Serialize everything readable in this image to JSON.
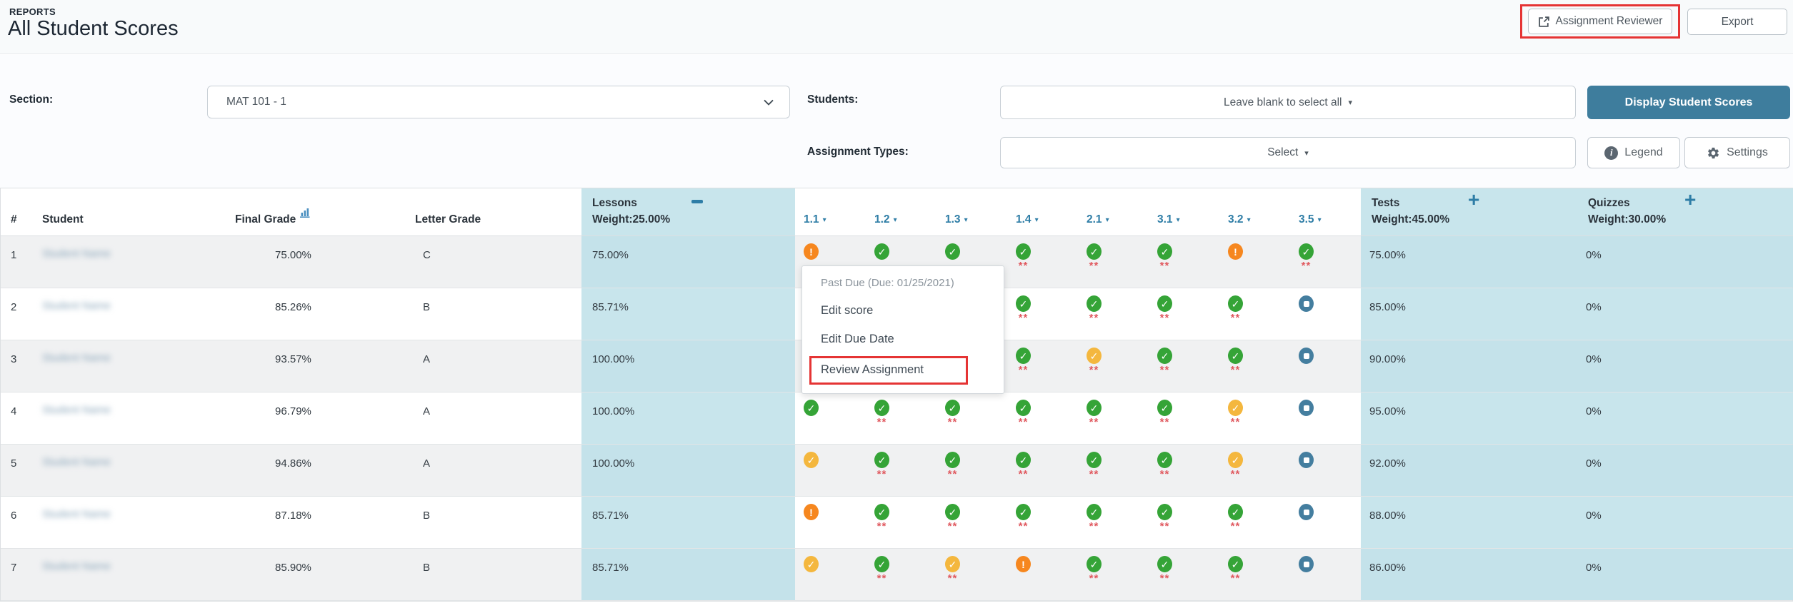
{
  "page": {
    "eyebrow": "REPORTS",
    "title": "All Student Scores"
  },
  "toolbar": {
    "assignment_reviewer": "Assignment Reviewer",
    "export": "Export"
  },
  "filters": {
    "section_label": "Section:",
    "section_value": "MAT 101 - 1",
    "students_label": "Students:",
    "students_placeholder": "Leave blank to select all",
    "display_scores_button": "Display Student Scores",
    "assignment_types_label": "Assignment Types:",
    "assignment_types_placeholder": "Select",
    "legend_button": "Legend",
    "settings_button": "Settings"
  },
  "table": {
    "headers": {
      "num": "#",
      "student": "Student",
      "final_grade": "Final Grade",
      "letter_grade": "Letter Grade"
    },
    "groups": {
      "lessons": {
        "title": "Lessons",
        "weight": "Weight:25.00%",
        "toggle": "collapse"
      },
      "tests": {
        "title": "Tests",
        "weight": "Weight:45.00%",
        "toggle": "expand"
      },
      "quizzes": {
        "title": "Quizzes",
        "weight": "Weight:30.00%",
        "toggle": "expand"
      }
    },
    "assignment_columns": [
      "1.1",
      "1.2",
      "1.3",
      "1.4",
      "2.1",
      "3.1",
      "3.2",
      "3.5"
    ],
    "stars_marker": "**",
    "rows": [
      {
        "num": "1",
        "name_redacted": true,
        "name_placeholder": "Student Name",
        "final_grade": "75.00%",
        "letter_grade": "C",
        "lessons": "75.00%",
        "tests": "75.00%",
        "quizzes": "0%",
        "cells": [
          {
            "icon": "warning-orange",
            "stars": false
          },
          {
            "icon": "check-green",
            "stars": false
          },
          {
            "icon": "check-green",
            "stars": false
          },
          {
            "icon": "check-green",
            "stars": true
          },
          {
            "icon": "check-green",
            "stars": true
          },
          {
            "icon": "check-green",
            "stars": true
          },
          {
            "icon": "warning-orange",
            "stars": false
          },
          {
            "icon": "check-green",
            "stars": true
          }
        ]
      },
      {
        "num": "2",
        "name_redacted": true,
        "name_placeholder": "Student Name",
        "final_grade": "85.26%",
        "letter_grade": "B",
        "lessons": "85.71%",
        "tests": "85.00%",
        "quizzes": "0%",
        "cells": [
          {
            "icon": "covered",
            "stars": false
          },
          {
            "icon": "covered",
            "stars": false
          },
          {
            "icon": "covered",
            "stars": false
          },
          {
            "icon": "check-green",
            "stars": true
          },
          {
            "icon": "check-green",
            "stars": true
          },
          {
            "icon": "check-green",
            "stars": true
          },
          {
            "icon": "check-green",
            "stars": true
          },
          {
            "icon": "stop-blue",
            "stars": false
          }
        ]
      },
      {
        "num": "3",
        "name_redacted": true,
        "name_placeholder": "Student Name",
        "final_grade": "93.57%",
        "letter_grade": "A",
        "lessons": "100.00%",
        "tests": "90.00%",
        "quizzes": "0%",
        "cells": [
          {
            "icon": "covered",
            "stars": false
          },
          {
            "icon": "covered",
            "stars": false
          },
          {
            "icon": "covered",
            "stars": false
          },
          {
            "icon": "check-green",
            "stars": true
          },
          {
            "icon": "check-yellow",
            "stars": true
          },
          {
            "icon": "check-green",
            "stars": true
          },
          {
            "icon": "check-green",
            "stars": true
          },
          {
            "icon": "stop-blue",
            "stars": false
          }
        ]
      },
      {
        "num": "4",
        "name_redacted": true,
        "name_placeholder": "Student Name",
        "final_grade": "96.79%",
        "letter_grade": "A",
        "lessons": "100.00%",
        "tests": "95.00%",
        "quizzes": "0%",
        "cells": [
          {
            "icon": "check-green",
            "stars": false
          },
          {
            "icon": "check-green",
            "stars": true
          },
          {
            "icon": "check-green",
            "stars": true
          },
          {
            "icon": "check-green",
            "stars": true
          },
          {
            "icon": "check-green",
            "stars": true
          },
          {
            "icon": "check-green",
            "stars": true
          },
          {
            "icon": "check-yellow",
            "stars": true
          },
          {
            "icon": "stop-blue",
            "stars": false
          }
        ]
      },
      {
        "num": "5",
        "name_redacted": true,
        "name_placeholder": "Student Name",
        "final_grade": "94.86%",
        "letter_grade": "A",
        "lessons": "100.00%",
        "tests": "92.00%",
        "quizzes": "0%",
        "cells": [
          {
            "icon": "check-yellow",
            "stars": false
          },
          {
            "icon": "check-green",
            "stars": true
          },
          {
            "icon": "check-green",
            "stars": true
          },
          {
            "icon": "check-green",
            "stars": true
          },
          {
            "icon": "check-green",
            "stars": true
          },
          {
            "icon": "check-green",
            "stars": true
          },
          {
            "icon": "check-yellow",
            "stars": true
          },
          {
            "icon": "stop-blue",
            "stars": false
          }
        ]
      },
      {
        "num": "6",
        "name_redacted": true,
        "name_placeholder": "Student Name",
        "final_grade": "87.18%",
        "letter_grade": "B",
        "lessons": "85.71%",
        "tests": "88.00%",
        "quizzes": "0%",
        "cells": [
          {
            "icon": "warning-orange",
            "stars": false
          },
          {
            "icon": "check-green",
            "stars": true
          },
          {
            "icon": "check-green",
            "stars": true
          },
          {
            "icon": "check-green",
            "stars": true
          },
          {
            "icon": "check-green",
            "stars": true
          },
          {
            "icon": "check-green",
            "stars": true
          },
          {
            "icon": "check-green",
            "stars": true
          },
          {
            "icon": "stop-blue",
            "stars": false
          }
        ]
      },
      {
        "num": "7",
        "name_redacted": true,
        "name_placeholder": "Student Name",
        "final_grade": "85.90%",
        "letter_grade": "B",
        "lessons": "85.71%",
        "tests": "86.00%",
        "quizzes": "0%",
        "cells": [
          {
            "icon": "check-yellow",
            "stars": false
          },
          {
            "icon": "check-green",
            "stars": true
          },
          {
            "icon": "check-yellow",
            "stars": true
          },
          {
            "icon": "warning-orange",
            "stars": false
          },
          {
            "icon": "check-green",
            "stars": true
          },
          {
            "icon": "check-green",
            "stars": true
          },
          {
            "icon": "check-green",
            "stars": true
          },
          {
            "icon": "stop-blue",
            "stars": false
          }
        ]
      }
    ]
  },
  "context_menu": {
    "status": "Past Due (Due: 01/25/2021)",
    "items": [
      "Edit score",
      "Edit Due Date",
      "Review Assignment"
    ],
    "highlighted": "Review Assignment"
  },
  "colors": {
    "accent_blue": "#2e7da6",
    "button_teal": "#3e7d9d",
    "cell_blue": "#c8e5ec",
    "check_green": "#35a437",
    "check_yellow": "#f4b73e",
    "warning_orange": "#f6871f",
    "stop_blue": "#447e9f",
    "stars_red": "#e0595f",
    "highlight_red": "#e53434"
  }
}
